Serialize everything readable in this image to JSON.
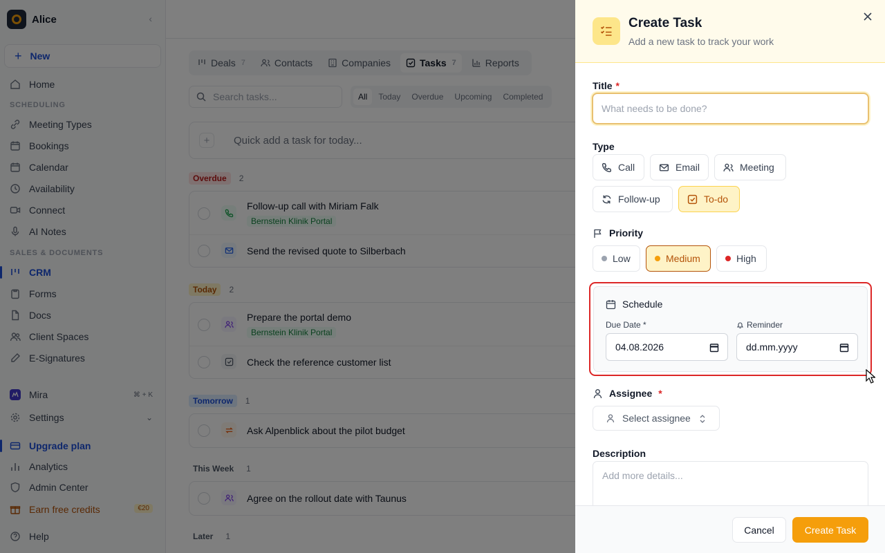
{
  "workspace": {
    "name": "Alice"
  },
  "sidebar": {
    "new_label": "New",
    "home": "Home",
    "section_scheduling": "SCHEDULING",
    "meeting_types": "Meeting Types",
    "bookings": "Bookings",
    "calendar": "Calendar",
    "availability": "Availability",
    "connect": "Connect",
    "ai_notes": "AI Notes",
    "section_sales": "SALES & DOCUMENTS",
    "crm": "CRM",
    "forms": "Forms",
    "docs": "Docs",
    "client_spaces": "Client Spaces",
    "esignatures": "E-Signatures",
    "mira": "Mira",
    "mira_shortcut": "⌘ + K",
    "settings": "Settings",
    "upgrade": "Upgrade plan",
    "analytics": "Analytics",
    "admin_center": "Admin Center",
    "earn_credits": "Earn free credits",
    "credits_badge": "€20",
    "help": "Help"
  },
  "main": {
    "tabs": [
      {
        "label": "Deals",
        "count": "7"
      },
      {
        "label": "Contacts",
        "count": ""
      },
      {
        "label": "Companies",
        "count": ""
      },
      {
        "label": "Tasks",
        "count": "7"
      },
      {
        "label": "Reports",
        "count": ""
      }
    ],
    "search_placeholder": "Search tasks...",
    "filters": [
      "All",
      "Today",
      "Overdue",
      "Upcoming",
      "Completed"
    ],
    "quick_add": "Quick add a task for today...",
    "groups": {
      "overdue": {
        "label": "Overdue",
        "count": "2"
      },
      "today": {
        "label": "Today",
        "count": "2"
      },
      "tomorrow": {
        "label": "Tomorrow",
        "count": "1"
      },
      "this_week": {
        "label": "This Week",
        "count": "1"
      },
      "later": {
        "label": "Later",
        "count": "1"
      }
    },
    "tasks": {
      "t1": {
        "title": "Follow-up call with Miriam Falk",
        "company": "Bernstein Klinik Portal"
      },
      "t2": {
        "title": "Send the revised quote to Silberbach"
      },
      "t3": {
        "title": "Prepare the portal demo",
        "company": "Bernstein Klinik Portal"
      },
      "t4": {
        "title": "Check the reference customer list"
      },
      "t5": {
        "title": "Ask Alpenblick about the pilot budget"
      },
      "t6": {
        "title": "Agree on the rollout date with Taunus"
      }
    }
  },
  "panel": {
    "title": "Create Task",
    "subtitle": "Add a new task to track your work",
    "title_label": "Title",
    "required_mark": "*",
    "title_placeholder": "What needs to be done?",
    "type_label": "Type",
    "types": {
      "call": "Call",
      "email": "Email",
      "meeting": "Meeting",
      "followup": "Follow-up",
      "todo": "To-do"
    },
    "selected_type": "To-do",
    "priority_label": "Priority",
    "priorities": {
      "low": "Low",
      "medium": "Medium",
      "high": "High"
    },
    "selected_priority": "Medium",
    "schedule_label": "Schedule",
    "due_date_label": "Due Date *",
    "due_date_value": "04.08.2026",
    "reminder_label": "Reminder",
    "reminder_placeholder": "dd.mm.yyyy",
    "assignee_label": "Assignee",
    "assignee_placeholder": "Select assignee",
    "description_label": "Description",
    "description_placeholder": "Add more details...",
    "cancel": "Cancel",
    "create": "Create Task"
  },
  "colors": {
    "accent": "#f59e0b",
    "brand_blue": "#1d4ed8",
    "highlight_red": "#dc2626"
  }
}
